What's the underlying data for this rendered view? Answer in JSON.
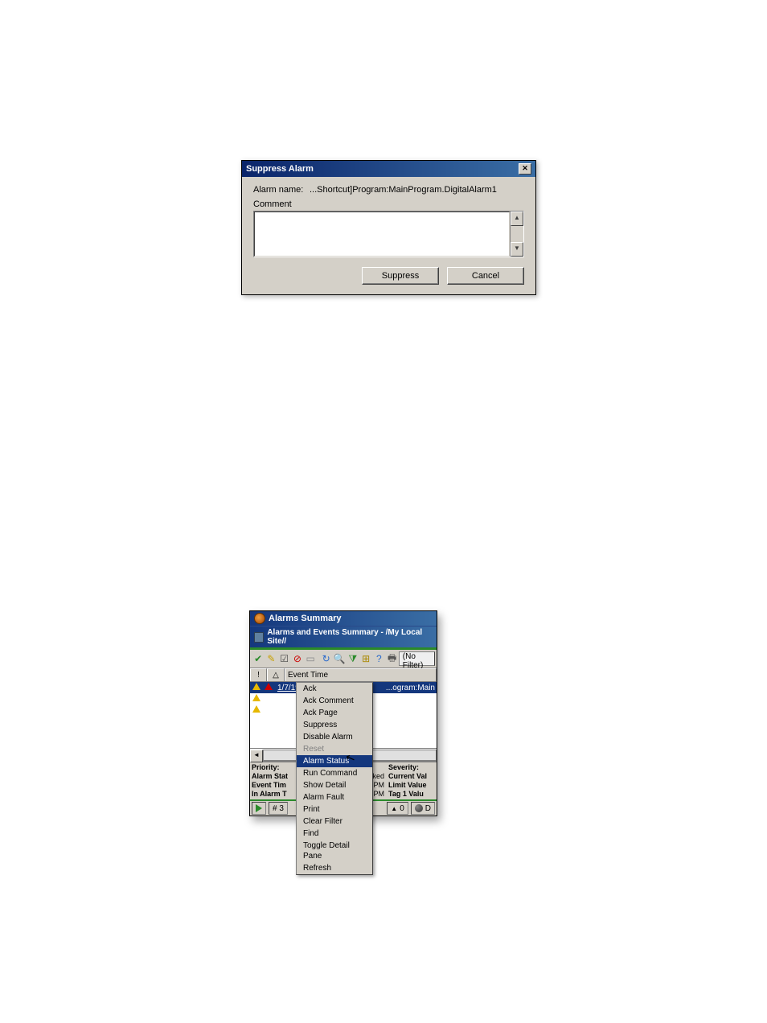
{
  "suppress_dialog": {
    "title": "Suppress Alarm",
    "alarm_name_label": "Alarm name:",
    "alarm_name_value": "...Shortcut]Program:MainProgram.DigitalAlarm1",
    "comment_label": "Comment",
    "suppress_btn": "Suppress",
    "cancel_btn": "Cancel"
  },
  "alarms_summary": {
    "window_title": "Alarms Summary",
    "subtitle": "Alarms and Events Summary - /My Local Site//",
    "no_filter_btn": "(No Filter)",
    "col_bang": "!",
    "col_bell": "🔔",
    "col_event_time": "Event Time",
    "rows": [
      {
        "time": "1/7/1998 4:49:20 PM",
        "source_tail": "...ogram:Main",
        "selected": true
      },
      {
        "time": "",
        "source_tail": "",
        "selected": false
      },
      {
        "time": "",
        "source_tail": "",
        "selected": false
      }
    ],
    "detail": {
      "left_labels": [
        "Priority:",
        "Alarm Stat",
        "Event Tim",
        "In Alarm T"
      ],
      "right_labels": [
        "Severity:",
        "Current Val",
        "Limit Value",
        "Tag 1 Valu"
      ],
      "mid_values_1": "ked",
      "mid_values_2": "28 PM",
      "mid_values_3": "28 PM"
    },
    "status": {
      "count": "# 3",
      "zero": "0",
      "d": "D"
    }
  },
  "context_menu": {
    "items": [
      {
        "label": "Ack",
        "disabled": false,
        "hl": false
      },
      {
        "label": "Ack Comment",
        "disabled": false,
        "hl": false
      },
      {
        "label": "Ack Page",
        "disabled": false,
        "hl": false
      },
      {
        "label": "Suppress",
        "disabled": false,
        "hl": false
      },
      {
        "label": "Disable Alarm",
        "disabled": false,
        "hl": false
      },
      {
        "label": "Reset",
        "disabled": true,
        "hl": false
      },
      {
        "label": "Alarm Status",
        "disabled": false,
        "hl": true
      },
      {
        "label": "Run Command",
        "disabled": false,
        "hl": false
      },
      {
        "label": "Show Detail",
        "disabled": false,
        "hl": false
      },
      {
        "label": "Alarm Fault",
        "disabled": false,
        "hl": false
      },
      {
        "label": "Print",
        "disabled": false,
        "hl": false
      },
      {
        "label": "Clear Filter",
        "disabled": false,
        "hl": false
      },
      {
        "label": "Find",
        "disabled": false,
        "hl": false
      },
      {
        "label": "Toggle Detail Pane",
        "disabled": false,
        "hl": false
      },
      {
        "label": "Refresh",
        "disabled": false,
        "hl": false
      }
    ]
  }
}
